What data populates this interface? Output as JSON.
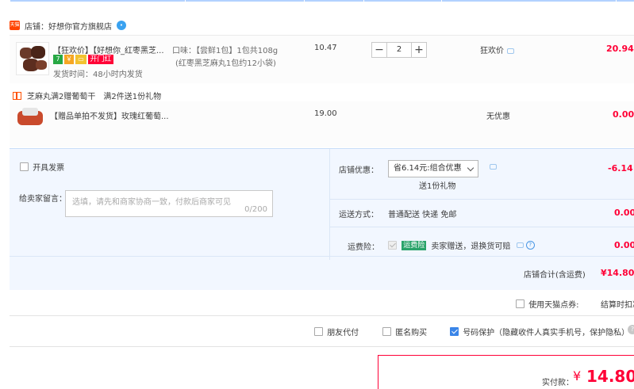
{
  "shop": {
    "label": "店铺：",
    "name": "好想你官方旗舰店",
    "logo_text": "天猫"
  },
  "items": [
    {
      "title": "【狂欢价】【好想你_红枣黑芝...",
      "badges": [
        "7",
        "￥",
        "▭",
        "开门红"
      ],
      "ship_time": "发货时间：48小时内发货",
      "sku_line1": "口味：【尝鲜1包】1包共108g",
      "sku_line2": "(红枣黑芝麻丸1包约12小袋)",
      "unit_price": "10.47",
      "qty": "2",
      "qty_minus": "−",
      "qty_plus": "+",
      "promo": "狂欢价",
      "subtotal": "20.94"
    },
    {
      "title": "【赠品单拍不发货】玫瑰红葡萄...",
      "unit_price": "19.00",
      "promo": "无优惠",
      "subtotal": "0.00"
    }
  ],
  "gift": {
    "text": "芝麻丸满2赠葡萄干",
    "detail": "满2件送1份礼物"
  },
  "invoice": {
    "label": "开具发票"
  },
  "message": {
    "label": "给卖家留言：",
    "placeholder": "选填，请先和商家协商一致，付款后商家可见",
    "counter": "0/200"
  },
  "shop_discount": {
    "label": "店铺优惠：",
    "selected": "省6.14元:组合优惠",
    "note": "送1份礼物",
    "amount": "-6.14"
  },
  "shipping": {
    "label": "运送方式：",
    "value": "普通配送 快递 免邮",
    "amount": "0.00"
  },
  "insurance": {
    "label": "运费险：",
    "tag": "运费险",
    "value": "卖家赠送，退换货可赔",
    "amount": "0.00"
  },
  "shop_total": {
    "label": "店铺合计(含运费)",
    "amount": "¥14.80"
  },
  "points": {
    "label": "使用天猫点券:",
    "right_text": "结算时扣减"
  },
  "options": [
    {
      "label": "朋友代付",
      "checked": false
    },
    {
      "label": "匿名购买",
      "checked": false
    },
    {
      "label": "号码保护（隐藏收件人真实手机号，保护隐私）",
      "checked": true
    }
  ],
  "payment": {
    "label": "实付款：",
    "currency": "¥",
    "amount": "14.80"
  },
  "colors": {
    "accent_red": "#ff0036",
    "panel_blue": "#f2f7ff",
    "check_blue": "#3a85e8"
  }
}
